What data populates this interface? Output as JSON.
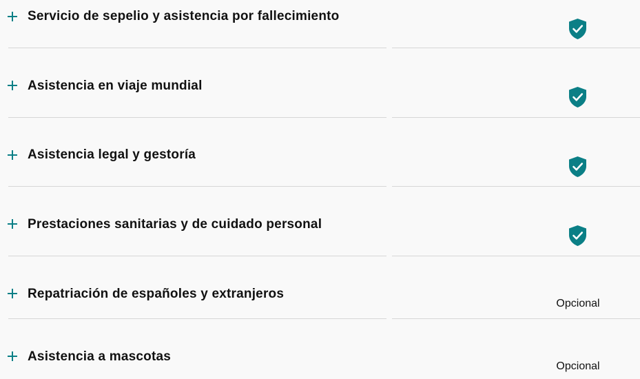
{
  "coverages": [
    {
      "title": "Servicio de sepelio y asistencia por fallecimiento",
      "included": true,
      "included_icon": "shield-check-icon"
    },
    {
      "title": "Asistencia en viaje mundial",
      "included": true,
      "included_icon": "shield-check-icon"
    },
    {
      "title": "Asistencia legal y gestoría",
      "included": true,
      "included_icon": "shield-check-icon"
    },
    {
      "title": "Prestaciones sanitarias y de cuidado personal",
      "included": true,
      "included_icon": "shield-check-icon"
    },
    {
      "title": "Repatriación de españoles y extranjeros",
      "included": false,
      "status_text": "Opcional"
    },
    {
      "title": "Asistencia a mascotas",
      "included": false,
      "status_text": "Opcional"
    }
  ],
  "colors": {
    "accent": "#0b7f86",
    "divider": "#d6d6d6",
    "background": "#f9f9f9"
  },
  "icons": {
    "expand": "plus-icon",
    "included": "shield-check-icon"
  }
}
